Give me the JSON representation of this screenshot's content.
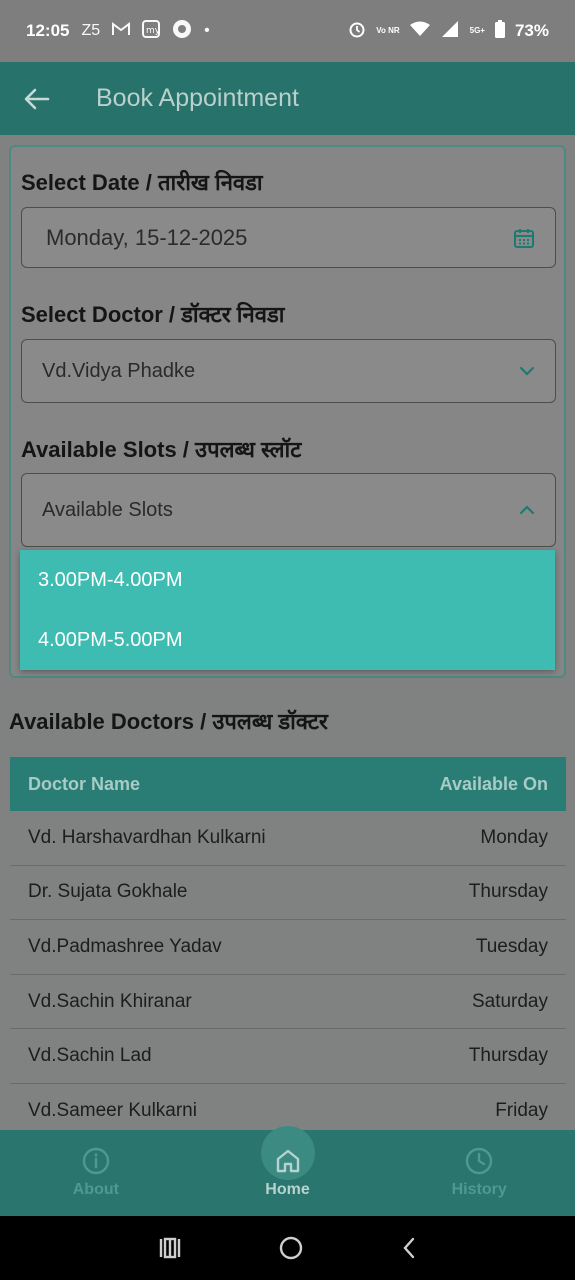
{
  "status_bar": {
    "time": "12:05",
    "notif_icons": [
      "Z5",
      "gmail-icon",
      "my-icon",
      "circle-app-icon",
      "dot"
    ],
    "battery": "73%",
    "network_labels": {
      "volte": "Vo NR",
      "fiveg": "5G+"
    }
  },
  "app_bar": {
    "title": "Book Appointment"
  },
  "form": {
    "date_label": "Select Date / तारीख निवडा",
    "date_value": "Monday, 15-12-2025",
    "doctor_label": "Select Doctor / डॉक्टर निवडा",
    "doctor_value": "Vd.Vidya Phadke",
    "slots_label": "Available Slots / उपलब्ध स्लॉट",
    "slots_placeholder": "Available Slots",
    "slot_options": [
      "3.00PM-4.00PM",
      "4.00PM-5.00PM"
    ]
  },
  "doctors": {
    "title": "Available Doctors / उपलब्ध डॉक्टर",
    "columns": [
      "Doctor Name",
      "Available On"
    ],
    "rows": [
      {
        "name": "Vd. Harshavardhan Kulkarni",
        "day": "Monday"
      },
      {
        "name": "Dr. Sujata Gokhale",
        "day": "Thursday"
      },
      {
        "name": "Vd.Padmashree Yadav",
        "day": "Tuesday"
      },
      {
        "name": "Vd.Sachin Khiranar",
        "day": "Saturday"
      },
      {
        "name": "Vd.Sachin Lad",
        "day": "Thursday"
      },
      {
        "name": "Vd.Sameer Kulkarni",
        "day": "Friday"
      }
    ]
  },
  "bottom_nav": {
    "about": "About",
    "home": "Home",
    "history": "History"
  },
  "colors": {
    "primary": "#27726a",
    "dropdown": "#3fbcb1",
    "table_header": "#2a7d74"
  }
}
